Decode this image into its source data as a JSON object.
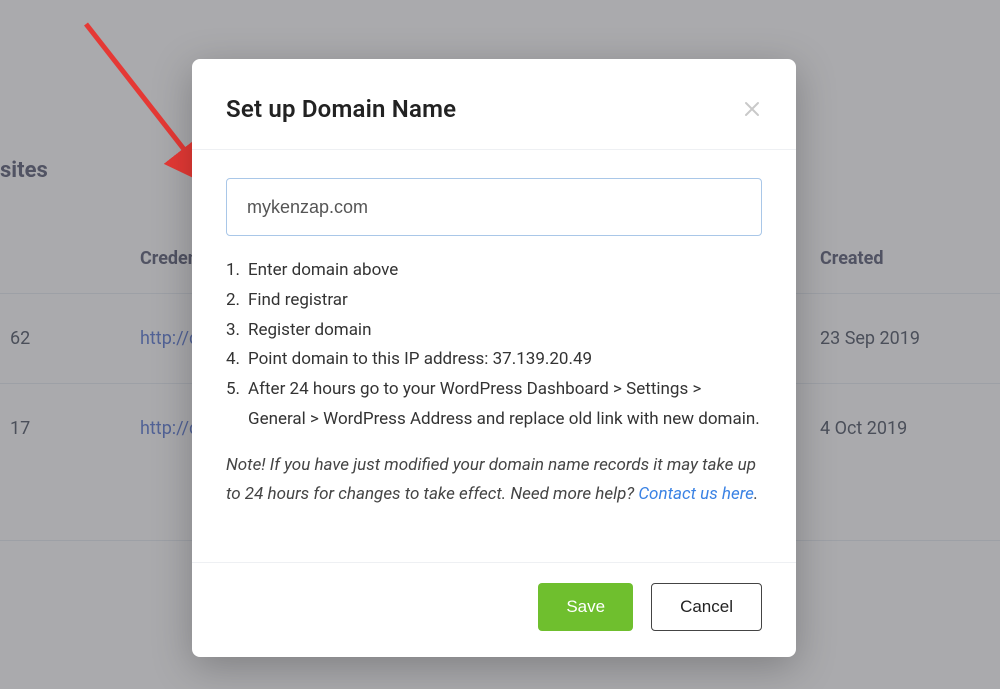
{
  "background": {
    "section_title": "sites",
    "columns": {
      "id_hidden": "",
      "credentials": "Credentials",
      "created": "Created"
    },
    "rows": [
      {
        "id_suffix": "62",
        "link": "http://clo",
        "created": "23 Sep 2019"
      },
      {
        "id_suffix": "17",
        "link": "http://clo",
        "created": "4 Oct 2019"
      }
    ]
  },
  "modal": {
    "title": "Set up Domain Name",
    "close_label": "Close",
    "domain_value": "mykenzap.com",
    "steps": [
      "Enter domain above",
      "Find registrar",
      "Register domain",
      "Point domain to this IP address: 37.139.20.49",
      "After 24 hours go to your WordPress Dashboard > Settings > General > WordPress Address and replace old link with new domain."
    ],
    "note_prefix": "Note! If you have just modified your domain name records it may take up to 24 hours for changes to take effect. Need more help? ",
    "note_link": "Contact us here",
    "note_suffix": ".",
    "save": "Save",
    "cancel": "Cancel"
  }
}
